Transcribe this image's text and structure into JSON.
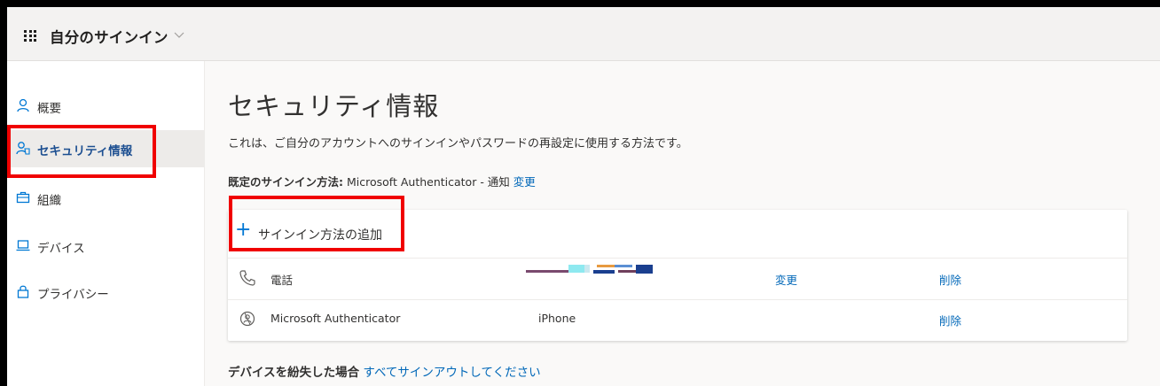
{
  "header": {
    "app_title": "自分のサインイン"
  },
  "nav": {
    "items": [
      {
        "label": "概要",
        "icon": "person-icon"
      },
      {
        "label": "セキュリティ情報",
        "icon": "security-info-icon"
      },
      {
        "label": "組織",
        "icon": "briefcase-icon"
      },
      {
        "label": "デバイス",
        "icon": "laptop-icon"
      },
      {
        "label": "プライバシー",
        "icon": "lock-icon"
      }
    ],
    "active_index": 1
  },
  "main": {
    "title": "セキュリティ情報",
    "description": "これは、ご自分のアカウントへのサインインやパスワードの再設定に使用する方法です。",
    "default_method_label": "既定のサインイン方法:",
    "default_method_value": "Microsoft Authenticator - 通知",
    "default_method_change": "変更",
    "add_method": {
      "plus": "+",
      "label": "サインイン方法の追加"
    },
    "methods": [
      {
        "name": "電話",
        "detail": "",
        "detail_redacted": true,
        "change": "変更",
        "delete": "削除",
        "icon": "phone-icon"
      },
      {
        "name": "Microsoft Authenticator",
        "detail": "iPhone",
        "change": "",
        "delete": "削除",
        "icon": "authenticator-icon"
      }
    ],
    "lost_device_label": "デバイスを紛失した場合",
    "lost_device_link": "すべてサインアウトしてください"
  },
  "colors": {
    "accent": "#0078d4",
    "link": "#0067b8",
    "highlight_box": "#f00000",
    "active_nav_text": "#1d4f91"
  }
}
